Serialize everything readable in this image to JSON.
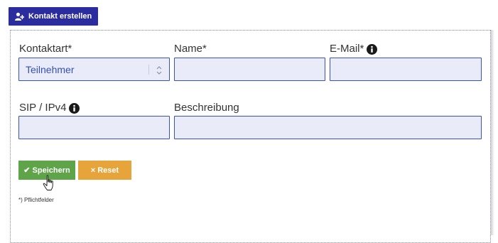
{
  "header": {
    "create_contact_label": "Kontakt erstellen",
    "icon": "add-user-icon"
  },
  "form": {
    "contact_type": {
      "label": "Kontaktart*",
      "value": "Teilnehmer"
    },
    "name": {
      "label": "Name*",
      "value": ""
    },
    "email": {
      "label": "E-Mail*",
      "value": "",
      "info_icon": "info-icon"
    },
    "sip": {
      "label": "SIP / IPv4",
      "value": "",
      "info_icon": "info-icon"
    },
    "description": {
      "label": "Beschreibung",
      "value": ""
    }
  },
  "actions": {
    "save_label": "Speichern",
    "save_glyph": "✔",
    "reset_label": "Reset",
    "reset_glyph": "×"
  },
  "footnote": "*) Pflichtfelder",
  "colors": {
    "header_button": "#2b2d9e",
    "input_border": "#3a52b6",
    "input_bg": "#e9ecf8",
    "save_button": "#5fa449",
    "reset_button": "#e6a43a"
  }
}
